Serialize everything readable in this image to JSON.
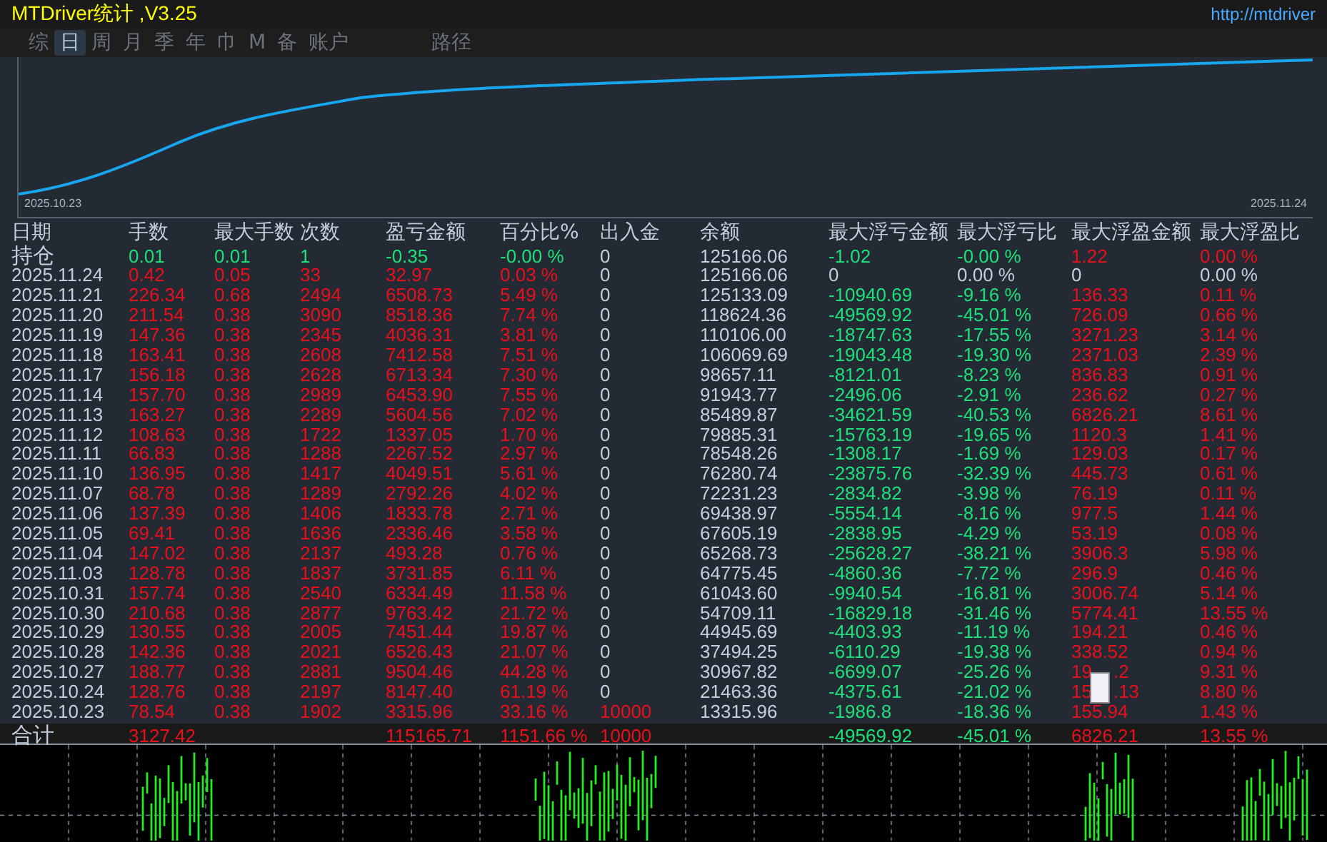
{
  "window": {
    "title": "MTDriver统计 ,V3.25",
    "url": "http://mtdriver"
  },
  "tabs": [
    {
      "label": "综",
      "selected": false
    },
    {
      "label": "日",
      "selected": true
    },
    {
      "label": "周",
      "selected": false
    },
    {
      "label": "月",
      "selected": false
    },
    {
      "label": "季",
      "selected": false
    },
    {
      "label": "年",
      "selected": false
    },
    {
      "label": "巾",
      "selected": false
    },
    {
      "label": "M",
      "selected": false
    },
    {
      "label": "备",
      "selected": false
    },
    {
      "label": "账户",
      "selected": false
    }
  ],
  "path_button": "路径",
  "equity_chart": {
    "start_label": "2025.10.23",
    "end_label": "2025.11.24"
  },
  "table": {
    "columns": [
      "日期",
      "手数",
      "最大手数",
      "次数",
      "盈亏金额",
      "百分比%",
      "出入金",
      "余额",
      "最大浮亏金额",
      "最大浮亏比",
      "最大浮盈金额",
      "最大浮盈比"
    ],
    "holding": [
      {
        "text": "持仓"
      },
      {
        "text": "0.01",
        "color": "#1ee07a"
      },
      {
        "text": "0.01",
        "color": "#1ee07a"
      },
      {
        "text": "1",
        "color": "#1ee07a"
      },
      {
        "text": "-0.35",
        "color": "#1ee07a"
      },
      {
        "text": "-0.00 %",
        "color": "#1ee07a"
      },
      {
        "text": "0"
      },
      {
        "text": "125166.06"
      },
      {
        "text": "-1.02",
        "color": "#1ee07a"
      },
      {
        "text": "-0.00 %",
        "color": "#1ee07a"
      },
      {
        "text": "1.22",
        "color": "#e8101c"
      },
      {
        "text": "0.00 %",
        "color": "#e8101c"
      }
    ],
    "rows": [
      [
        {
          "text": "2025.11.24"
        },
        {
          "text": "0.42",
          "color": "#e8101c"
        },
        {
          "text": "0.05",
          "color": "#e8101c"
        },
        {
          "text": "33",
          "color": "#e8101c"
        },
        {
          "text": "32.97",
          "color": "#e8101c"
        },
        {
          "text": "0.03 %",
          "color": "#e8101c"
        },
        {
          "text": "0"
        },
        {
          "text": "125166.06"
        },
        {
          "text": "0"
        },
        {
          "text": "0.00 %"
        },
        {
          "text": "0"
        },
        {
          "text": "0.00 %"
        }
      ],
      [
        {
          "text": "2025.11.21"
        },
        {
          "text": "226.34",
          "color": "#e8101c"
        },
        {
          "text": "0.68",
          "color": "#e8101c"
        },
        {
          "text": "2494",
          "color": "#e8101c"
        },
        {
          "text": "6508.73",
          "color": "#e8101c"
        },
        {
          "text": "5.49 %",
          "color": "#e8101c"
        },
        {
          "text": "0"
        },
        {
          "text": "125133.09"
        },
        {
          "text": "-10940.69",
          "color": "#1ee07a"
        },
        {
          "text": "-9.16 %",
          "color": "#1ee07a"
        },
        {
          "text": "136.33",
          "color": "#e8101c"
        },
        {
          "text": "0.11 %",
          "color": "#e8101c"
        }
      ],
      [
        {
          "text": "2025.11.20"
        },
        {
          "text": "211.54",
          "color": "#e8101c"
        },
        {
          "text": "0.38",
          "color": "#e8101c"
        },
        {
          "text": "3090",
          "color": "#e8101c"
        },
        {
          "text": "8518.36",
          "color": "#e8101c"
        },
        {
          "text": "7.74 %",
          "color": "#e8101c"
        },
        {
          "text": "0"
        },
        {
          "text": "118624.36"
        },
        {
          "text": "-49569.92",
          "color": "#1ee07a"
        },
        {
          "text": "-45.01 %",
          "color": "#1ee07a"
        },
        {
          "text": "726.09",
          "color": "#e8101c"
        },
        {
          "text": "0.66 %",
          "color": "#e8101c"
        }
      ],
      [
        {
          "text": "2025.11.19"
        },
        {
          "text": "147.36",
          "color": "#e8101c"
        },
        {
          "text": "0.38",
          "color": "#e8101c"
        },
        {
          "text": "2345",
          "color": "#e8101c"
        },
        {
          "text": "4036.31",
          "color": "#e8101c"
        },
        {
          "text": "3.81 %",
          "color": "#e8101c"
        },
        {
          "text": "0"
        },
        {
          "text": "110106.00"
        },
        {
          "text": "-18747.63",
          "color": "#1ee07a"
        },
        {
          "text": "-17.55 %",
          "color": "#1ee07a"
        },
        {
          "text": "3271.23",
          "color": "#e8101c"
        },
        {
          "text": "3.14 %",
          "color": "#e8101c"
        }
      ],
      [
        {
          "text": "2025.11.18"
        },
        {
          "text": "163.41",
          "color": "#e8101c"
        },
        {
          "text": "0.38",
          "color": "#e8101c"
        },
        {
          "text": "2608",
          "color": "#e8101c"
        },
        {
          "text": "7412.58",
          "color": "#e8101c"
        },
        {
          "text": "7.51 %",
          "color": "#e8101c"
        },
        {
          "text": "0"
        },
        {
          "text": "106069.69"
        },
        {
          "text": "-19043.48",
          "color": "#1ee07a"
        },
        {
          "text": "-19.30 %",
          "color": "#1ee07a"
        },
        {
          "text": "2371.03",
          "color": "#e8101c"
        },
        {
          "text": "2.39 %",
          "color": "#e8101c"
        }
      ],
      [
        {
          "text": "2025.11.17"
        },
        {
          "text": "156.18",
          "color": "#e8101c"
        },
        {
          "text": "0.38",
          "color": "#e8101c"
        },
        {
          "text": "2628",
          "color": "#e8101c"
        },
        {
          "text": "6713.34",
          "color": "#e8101c"
        },
        {
          "text": "7.30 %",
          "color": "#e8101c"
        },
        {
          "text": "0"
        },
        {
          "text": "98657.11"
        },
        {
          "text": "-8121.01",
          "color": "#1ee07a"
        },
        {
          "text": "-8.23 %",
          "color": "#1ee07a"
        },
        {
          "text": "836.83",
          "color": "#e8101c"
        },
        {
          "text": "0.91 %",
          "color": "#e8101c"
        }
      ],
      [
        {
          "text": "2025.11.14"
        },
        {
          "text": "157.70",
          "color": "#e8101c"
        },
        {
          "text": "0.38",
          "color": "#e8101c"
        },
        {
          "text": "2989",
          "color": "#e8101c"
        },
        {
          "text": "6453.90",
          "color": "#e8101c"
        },
        {
          "text": "7.55 %",
          "color": "#e8101c"
        },
        {
          "text": "0"
        },
        {
          "text": "91943.77"
        },
        {
          "text": "-2496.06",
          "color": "#1ee07a"
        },
        {
          "text": "-2.91 %",
          "color": "#1ee07a"
        },
        {
          "text": "236.62",
          "color": "#e8101c"
        },
        {
          "text": "0.27 %",
          "color": "#e8101c"
        }
      ],
      [
        {
          "text": "2025.11.13"
        },
        {
          "text": "163.27",
          "color": "#e8101c"
        },
        {
          "text": "0.38",
          "color": "#e8101c"
        },
        {
          "text": "2289",
          "color": "#e8101c"
        },
        {
          "text": "5604.56",
          "color": "#e8101c"
        },
        {
          "text": "7.02 %",
          "color": "#e8101c"
        },
        {
          "text": "0"
        },
        {
          "text": "85489.87"
        },
        {
          "text": "-34621.59",
          "color": "#1ee07a"
        },
        {
          "text": "-40.53 %",
          "color": "#1ee07a"
        },
        {
          "text": "6826.21",
          "color": "#e8101c"
        },
        {
          "text": "8.61 %",
          "color": "#e8101c"
        }
      ],
      [
        {
          "text": "2025.11.12"
        },
        {
          "text": "108.63",
          "color": "#e8101c"
        },
        {
          "text": "0.38",
          "color": "#e8101c"
        },
        {
          "text": "1722",
          "color": "#e8101c"
        },
        {
          "text": "1337.05",
          "color": "#e8101c"
        },
        {
          "text": "1.70 %",
          "color": "#e8101c"
        },
        {
          "text": "0"
        },
        {
          "text": "79885.31"
        },
        {
          "text": "-15763.19",
          "color": "#1ee07a"
        },
        {
          "text": "-19.65 %",
          "color": "#1ee07a"
        },
        {
          "text": "1120.3",
          "color": "#e8101c"
        },
        {
          "text": "1.41 %",
          "color": "#e8101c"
        }
      ],
      [
        {
          "text": "2025.11.11"
        },
        {
          "text": "66.83",
          "color": "#e8101c"
        },
        {
          "text": "0.38",
          "color": "#e8101c"
        },
        {
          "text": "1288",
          "color": "#e8101c"
        },
        {
          "text": "2267.52",
          "color": "#e8101c"
        },
        {
          "text": "2.97 %",
          "color": "#e8101c"
        },
        {
          "text": "0"
        },
        {
          "text": "78548.26"
        },
        {
          "text": "-1308.17",
          "color": "#1ee07a"
        },
        {
          "text": "-1.69 %",
          "color": "#1ee07a"
        },
        {
          "text": "129.03",
          "color": "#e8101c"
        },
        {
          "text": "0.17 %",
          "color": "#e8101c"
        }
      ],
      [
        {
          "text": "2025.11.10"
        },
        {
          "text": "136.95",
          "color": "#e8101c"
        },
        {
          "text": "0.38",
          "color": "#e8101c"
        },
        {
          "text": "1417",
          "color": "#e8101c"
        },
        {
          "text": "4049.51",
          "color": "#e8101c"
        },
        {
          "text": "5.61 %",
          "color": "#e8101c"
        },
        {
          "text": "0"
        },
        {
          "text": "76280.74"
        },
        {
          "text": "-23875.76",
          "color": "#1ee07a"
        },
        {
          "text": "-32.39 %",
          "color": "#1ee07a"
        },
        {
          "text": "445.73",
          "color": "#e8101c"
        },
        {
          "text": "0.61 %",
          "color": "#e8101c"
        }
      ],
      [
        {
          "text": "2025.11.07"
        },
        {
          "text": "68.78",
          "color": "#e8101c"
        },
        {
          "text": "0.38",
          "color": "#e8101c"
        },
        {
          "text": "1289",
          "color": "#e8101c"
        },
        {
          "text": "2792.26",
          "color": "#e8101c"
        },
        {
          "text": "4.02 %",
          "color": "#e8101c"
        },
        {
          "text": "0"
        },
        {
          "text": "72231.23"
        },
        {
          "text": "-2834.82",
          "color": "#1ee07a"
        },
        {
          "text": "-3.98 %",
          "color": "#1ee07a"
        },
        {
          "text": "76.19",
          "color": "#e8101c"
        },
        {
          "text": "0.11 %",
          "color": "#e8101c"
        }
      ],
      [
        {
          "text": "2025.11.06"
        },
        {
          "text": "137.39",
          "color": "#e8101c"
        },
        {
          "text": "0.38",
          "color": "#e8101c"
        },
        {
          "text": "1406",
          "color": "#e8101c"
        },
        {
          "text": "1833.78",
          "color": "#e8101c"
        },
        {
          "text": "2.71 %",
          "color": "#e8101c"
        },
        {
          "text": "0"
        },
        {
          "text": "69438.97"
        },
        {
          "text": "-5554.14",
          "color": "#1ee07a"
        },
        {
          "text": "-8.16 %",
          "color": "#1ee07a"
        },
        {
          "text": "977.5",
          "color": "#e8101c"
        },
        {
          "text": "1.44 %",
          "color": "#e8101c"
        }
      ],
      [
        {
          "text": "2025.11.05"
        },
        {
          "text": "69.41",
          "color": "#e8101c"
        },
        {
          "text": "0.38",
          "color": "#e8101c"
        },
        {
          "text": "1636",
          "color": "#e8101c"
        },
        {
          "text": "2336.46",
          "color": "#e8101c"
        },
        {
          "text": "3.58 %",
          "color": "#e8101c"
        },
        {
          "text": "0"
        },
        {
          "text": "67605.19"
        },
        {
          "text": "-2838.95",
          "color": "#1ee07a"
        },
        {
          "text": "-4.29 %",
          "color": "#1ee07a"
        },
        {
          "text": "53.19",
          "color": "#e8101c"
        },
        {
          "text": "0.08 %",
          "color": "#e8101c"
        }
      ],
      [
        {
          "text": "2025.11.04"
        },
        {
          "text": "147.02",
          "color": "#e8101c"
        },
        {
          "text": "0.38",
          "color": "#e8101c"
        },
        {
          "text": "2137",
          "color": "#e8101c"
        },
        {
          "text": "493.28",
          "color": "#e8101c"
        },
        {
          "text": "0.76 %",
          "color": "#e8101c"
        },
        {
          "text": "0"
        },
        {
          "text": "65268.73"
        },
        {
          "text": "-25628.27",
          "color": "#1ee07a"
        },
        {
          "text": "-38.21 %",
          "color": "#1ee07a"
        },
        {
          "text": "3906.3",
          "color": "#e8101c"
        },
        {
          "text": "5.98 %",
          "color": "#e8101c"
        }
      ],
      [
        {
          "text": "2025.11.03"
        },
        {
          "text": "128.78",
          "color": "#e8101c"
        },
        {
          "text": "0.38",
          "color": "#e8101c"
        },
        {
          "text": "1837",
          "color": "#e8101c"
        },
        {
          "text": "3731.85",
          "color": "#e8101c"
        },
        {
          "text": "6.11 %",
          "color": "#e8101c"
        },
        {
          "text": "0"
        },
        {
          "text": "64775.45"
        },
        {
          "text": "-4860.36",
          "color": "#1ee07a"
        },
        {
          "text": "-7.72 %",
          "color": "#1ee07a"
        },
        {
          "text": "296.9",
          "color": "#e8101c"
        },
        {
          "text": "0.46 %",
          "color": "#e8101c"
        }
      ],
      [
        {
          "text": "2025.10.31"
        },
        {
          "text": "157.74",
          "color": "#e8101c"
        },
        {
          "text": "0.38",
          "color": "#e8101c"
        },
        {
          "text": "2540",
          "color": "#e8101c"
        },
        {
          "text": "6334.49",
          "color": "#e8101c"
        },
        {
          "text": "11.58 %",
          "color": "#e8101c"
        },
        {
          "text": "0"
        },
        {
          "text": "61043.60"
        },
        {
          "text": "-9940.54",
          "color": "#1ee07a"
        },
        {
          "text": "-16.81 %",
          "color": "#1ee07a"
        },
        {
          "text": "3006.74",
          "color": "#e8101c"
        },
        {
          "text": "5.14 %",
          "color": "#e8101c"
        }
      ],
      [
        {
          "text": "2025.10.30"
        },
        {
          "text": "210.68",
          "color": "#e8101c"
        },
        {
          "text": "0.38",
          "color": "#e8101c"
        },
        {
          "text": "2877",
          "color": "#e8101c"
        },
        {
          "text": "9763.42",
          "color": "#e8101c"
        },
        {
          "text": "21.72 %",
          "color": "#e8101c"
        },
        {
          "text": "0"
        },
        {
          "text": "54709.11"
        },
        {
          "text": "-16829.18",
          "color": "#1ee07a"
        },
        {
          "text": "-31.46 %",
          "color": "#1ee07a"
        },
        {
          "text": "5774.41",
          "color": "#e8101c"
        },
        {
          "text": "13.55 %",
          "color": "#e8101c"
        }
      ],
      [
        {
          "text": "2025.10.29"
        },
        {
          "text": "130.55",
          "color": "#e8101c"
        },
        {
          "text": "0.38",
          "color": "#e8101c"
        },
        {
          "text": "2005",
          "color": "#e8101c"
        },
        {
          "text": "7451.44",
          "color": "#e8101c"
        },
        {
          "text": "19.87 %",
          "color": "#e8101c"
        },
        {
          "text": "0"
        },
        {
          "text": "44945.69"
        },
        {
          "text": "-4403.93",
          "color": "#1ee07a"
        },
        {
          "text": "-11.19 %",
          "color": "#1ee07a"
        },
        {
          "text": "194.21",
          "color": "#e8101c"
        },
        {
          "text": "0.46 %",
          "color": "#e8101c"
        }
      ],
      [
        {
          "text": "2025.10.28"
        },
        {
          "text": "142.36",
          "color": "#e8101c"
        },
        {
          "text": "0.38",
          "color": "#e8101c"
        },
        {
          "text": "2021",
          "color": "#e8101c"
        },
        {
          "text": "6526.43",
          "color": "#e8101c"
        },
        {
          "text": "21.07 %",
          "color": "#e8101c"
        },
        {
          "text": "0"
        },
        {
          "text": "37494.25"
        },
        {
          "text": "-6110.29",
          "color": "#1ee07a"
        },
        {
          "text": "-19.38 %",
          "color": "#1ee07a"
        },
        {
          "text": "338.52",
          "color": "#e8101c"
        },
        {
          "text": "0.94 %",
          "color": "#e8101c"
        }
      ],
      [
        {
          "text": "2025.10.27"
        },
        {
          "text": "188.77",
          "color": "#e8101c"
        },
        {
          "text": "0.38",
          "color": "#e8101c"
        },
        {
          "text": "2881",
          "color": "#e8101c"
        },
        {
          "text": "9504.46",
          "color": "#e8101c"
        },
        {
          "text": "44.28 %",
          "color": "#e8101c"
        },
        {
          "text": "0"
        },
        {
          "text": "30967.82"
        },
        {
          "text": "-6699.07",
          "color": "#1ee07a"
        },
        {
          "text": "-25.26 %",
          "color": "#1ee07a"
        },
        {
          "parts": [
            "19",
            ".2"
          ],
          "color": "#e8101c"
        },
        {
          "text": "9.31 %",
          "color": "#e8101c"
        }
      ],
      [
        {
          "text": "2025.10.24"
        },
        {
          "text": "128.76",
          "color": "#e8101c"
        },
        {
          "text": "0.38",
          "color": "#e8101c"
        },
        {
          "text": "2197",
          "color": "#e8101c"
        },
        {
          "text": "8147.40",
          "color": "#e8101c"
        },
        {
          "text": "61.19 %",
          "color": "#e8101c"
        },
        {
          "text": "0"
        },
        {
          "text": "21463.36"
        },
        {
          "text": "-4375.61",
          "color": "#1ee07a"
        },
        {
          "text": "-21.02 %",
          "color": "#1ee07a"
        },
        {
          "parts": [
            "15",
            ".13"
          ],
          "color": "#e8101c"
        },
        {
          "text": "8.80 %",
          "color": "#e8101c"
        }
      ],
      [
        {
          "text": "2025.10.23"
        },
        {
          "text": "78.54",
          "color": "#e8101c"
        },
        {
          "text": "0.38",
          "color": "#e8101c"
        },
        {
          "text": "1902",
          "color": "#e8101c"
        },
        {
          "text": "3315.96",
          "color": "#e8101c"
        },
        {
          "text": "33.16 %",
          "color": "#e8101c"
        },
        {
          "text": "10000",
          "color": "#e8101c"
        },
        {
          "text": "13315.96"
        },
        {
          "text": "-1986.8",
          "color": "#1ee07a"
        },
        {
          "text": "-18.36 %",
          "color": "#1ee07a"
        },
        {
          "text": "155.94",
          "color": "#e8101c"
        },
        {
          "text": "1.43 %",
          "color": "#e8101c"
        }
      ]
    ],
    "total": {
      "label": "合计",
      "lots": {
        "text": "3127.42",
        "color": "#e8101c"
      },
      "profit": {
        "text": "115165.71",
        "color": "#e8101c"
      },
      "percent": {
        "text": "1151.66 %",
        "color": "#e8101c"
      },
      "deposit": {
        "text": "10000",
        "color": "#e8101c"
      },
      "max_float_loss": {
        "text": "-49569.92",
        "color": "#1ee07a"
      },
      "max_float_loss_pct": {
        "text": "-45.01 %",
        "color": "#1ee07a"
      },
      "max_float_profit": {
        "text": "6826.21",
        "color": "#e8101c"
      },
      "max_float_profit_pct": {
        "text": "13.55 %",
        "color": "#e8101c"
      }
    }
  }
}
